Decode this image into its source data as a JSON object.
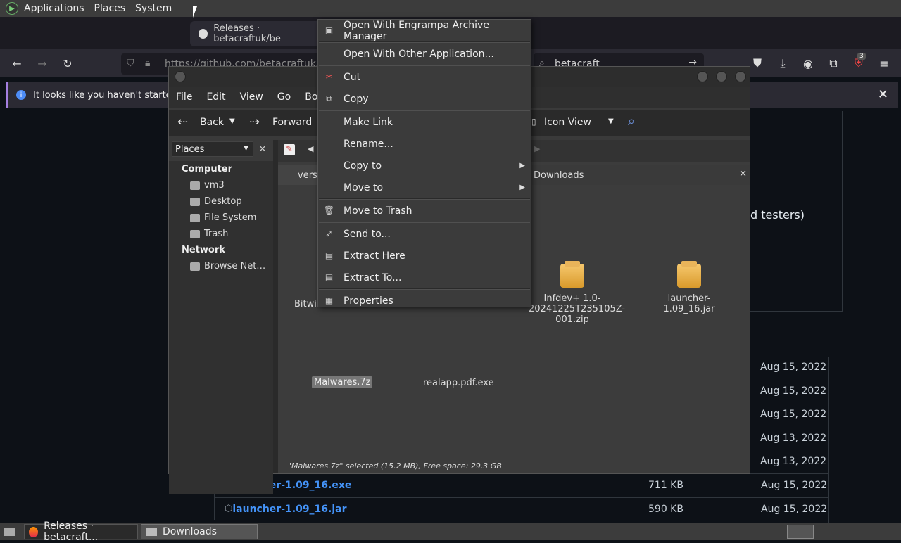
{
  "top_panel": {
    "menus": [
      "Applications",
      "Places",
      "System"
    ]
  },
  "firefox": {
    "tab_title": "Releases · betacraftuk/be",
    "url": "https://github.com/betacraftuk/bet",
    "search_value": "betacraft",
    "notice_text": "It looks like you haven't started Fi",
    "extensions_badge": "3"
  },
  "github": {
    "partial_text": "d testers)",
    "dates": [
      "Aug 15, 2022",
      "Aug 15, 2022",
      "Aug 15, 2022",
      "Aug 13, 2022",
      "Aug 13, 2022"
    ],
    "assets": [
      {
        "name": "launcher-1.09_16.exe",
        "size": "711 KB",
        "date": "Aug 15, 2022"
      },
      {
        "name": "launcher-1.09_16.jar",
        "size": "590 KB",
        "date": "Aug 15, 2022"
      }
    ]
  },
  "file_manager": {
    "menus": [
      "File",
      "Edit",
      "View",
      "Go",
      "Book"
    ],
    "toolbar": {
      "back": "Back",
      "forward": "Forward",
      "view_mode": "Icon View"
    },
    "sidebar_selector": "Places",
    "sidebar": {
      "computer_header": "Computer",
      "computer_items": [
        "vm3",
        "Desktop",
        "File System",
        "Trash"
      ],
      "network_header": "Network",
      "network_items": [
        "Browse Net…"
      ]
    },
    "tab_left": "versi",
    "tab_right": "Downloads",
    "files": [
      {
        "name": "Bitwis"
      },
      {
        "name": "Malwares.7z"
      },
      {
        "name": "realapp.pdf.exe"
      },
      {
        "name": "Infdev+ 1.0-20241225T235105Z-001.zip"
      },
      {
        "name": "launcher-1.09_16.jar"
      }
    ],
    "status": "\"Malwares.7z\" selected (15.2 MB), Free space: 29.3 GB"
  },
  "context_menu": {
    "items": [
      {
        "label": "Open With Engrampa Archive Manager",
        "icon": "archive-icon"
      },
      {
        "label": "Open With Other Application...",
        "icon": ""
      },
      {
        "label": "Cut",
        "icon": "scissors-icon"
      },
      {
        "label": "Copy",
        "icon": "copy-icon"
      },
      {
        "label": "Make Link",
        "icon": ""
      },
      {
        "label": "Rename...",
        "icon": ""
      },
      {
        "label": "Copy to",
        "icon": "",
        "submenu": true
      },
      {
        "label": "Move to",
        "icon": "",
        "submenu": true
      },
      {
        "label": "Move to Trash",
        "icon": "trash-icon"
      },
      {
        "label": "Send to...",
        "icon": "send-icon"
      },
      {
        "label": "Extract Here",
        "icon": "extract-icon"
      },
      {
        "label": "Extract To...",
        "icon": "extract-icon"
      },
      {
        "label": "Properties",
        "icon": "properties-icon"
      }
    ]
  },
  "taskbar": {
    "tasks": [
      "Releases · betacraft...",
      "Downloads"
    ]
  }
}
